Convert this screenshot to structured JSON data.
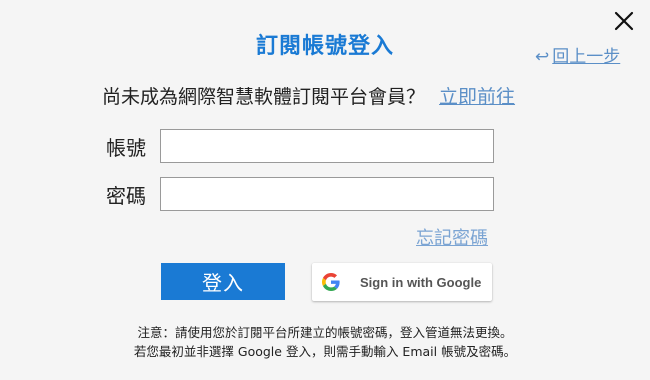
{
  "dialog": {
    "title": "訂閱帳號登入",
    "back_label": "回上一步",
    "colors": {
      "accent": "#1a7ad4",
      "link": "#5b8fc7",
      "background": "#f5f5f5"
    }
  },
  "register": {
    "question": "尚未成為網際智慧軟體訂閱平台會員？",
    "link_label": "立即前往"
  },
  "form": {
    "account_label": "帳號",
    "account_value": "",
    "password_label": "密碼",
    "password_value": "",
    "forgot_label": "忘記密碼"
  },
  "buttons": {
    "login_label": "登入",
    "google_label": "Sign in with Google"
  },
  "notes": {
    "line1": "注意：請使用您於訂閱平台所建立的帳號密碼，登入管道無法更換。",
    "line2": "若您最初並非選擇 Google 登入，則需手動輸入 Email 帳號及密碼。"
  },
  "icons": {
    "close": "close-icon",
    "back": "back-arrow-icon",
    "google": "google-logo-icon"
  }
}
